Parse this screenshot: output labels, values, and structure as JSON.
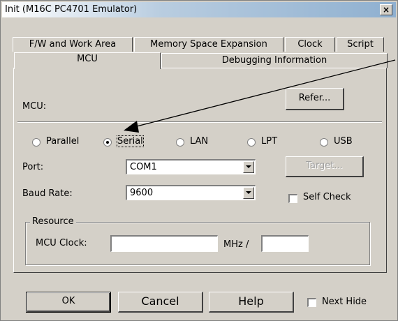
{
  "window": {
    "title": "Init (M16C PC4701 Emulator)",
    "close_label": "×"
  },
  "tabs": {
    "back_row": [
      "F/W and Work Area",
      "Memory Space Expansion",
      "Clock",
      "Script"
    ],
    "front_row": [
      "MCU",
      "Debugging Information"
    ],
    "selected": "MCU"
  },
  "mcu": {
    "label": "MCU:",
    "value": "",
    "refer_button": "Refer..."
  },
  "connection": {
    "options": [
      "Parallel",
      "Serial",
      "LAN",
      "LPT",
      "USB"
    ],
    "selected": "Serial"
  },
  "port": {
    "label": "Port:",
    "value": "COM1"
  },
  "target_button": "Target...",
  "baud": {
    "label": "Baud Rate:",
    "value": "9600"
  },
  "self_check": {
    "label": "Self Check",
    "checked": false
  },
  "resource": {
    "group_label": "Resource",
    "mcu_clock_label": "MCU Clock:",
    "mcu_clock_value": "",
    "unit": "MHz /",
    "divider_value": ""
  },
  "footer": {
    "ok": "OK",
    "cancel": "Cancel",
    "help": "Help",
    "next_hide": "Next Hide",
    "next_hide_checked": false
  }
}
